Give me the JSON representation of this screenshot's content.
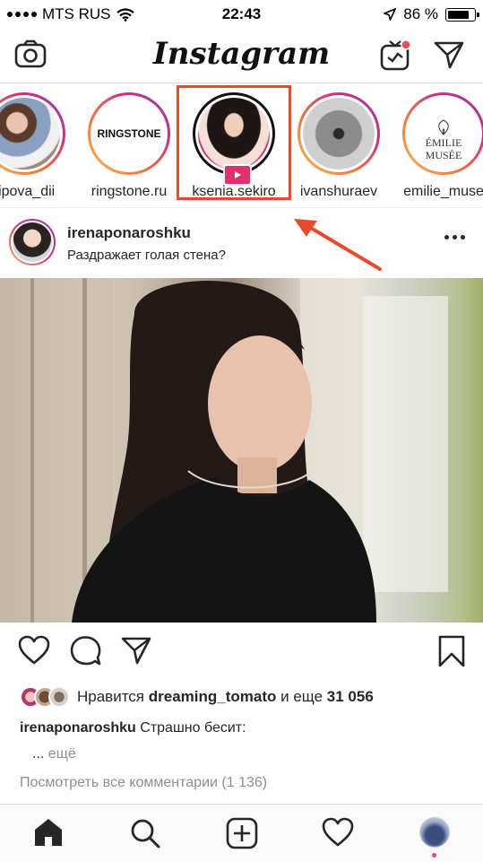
{
  "status_bar": {
    "carrier": "MTS RUS",
    "time": "22:43",
    "battery_percent": "86 %",
    "battery_level": 0.86
  },
  "header": {
    "logo": "Instagram",
    "icons": [
      "camera-icon",
      "igtv-icon",
      "direct-message-icon"
    ]
  },
  "stories": [
    {
      "name": "ripova_dii",
      "avatar": "girl-with-dog"
    },
    {
      "name": "ringstone.ru",
      "avatar_text": "RINGSTONE"
    },
    {
      "name": "ksenia.sekiro",
      "avatar": "portrait-drawing",
      "badge": "igtv-play-badge"
    },
    {
      "name": "ivanshuraev",
      "avatar": "furry-puppet"
    },
    {
      "name": "emilie_muse",
      "avatar_text_1": "ÉMILIE",
      "avatar_text_2": "MUSÉE"
    }
  ],
  "post": {
    "username": "irenaponaroshku",
    "subtitle": "Раздражает голая стена?",
    "likes_prefix": "Нравится",
    "liked_by": "dreaming_tomato",
    "likes_connector": "и еще",
    "likes_count": "31 056",
    "caption_user": "irenaponaroshku",
    "caption_text": "Страшно бесит:",
    "caption_ellipsis": "...",
    "more_label": "ещё",
    "view_comments": "Посмотреть все комментарии (1 136)"
  },
  "colors": {
    "highlight": "#ea4a2a",
    "story_gradient": [
      "#fdb853",
      "#f5773a",
      "#d62e78",
      "#8a3ab9"
    ],
    "secondary_text": "#8e8e8e",
    "notification": "#ed4956"
  },
  "tab_bar": [
    "home-icon",
    "search-icon",
    "new-post-icon",
    "activity-heart-icon",
    "profile-avatar"
  ]
}
